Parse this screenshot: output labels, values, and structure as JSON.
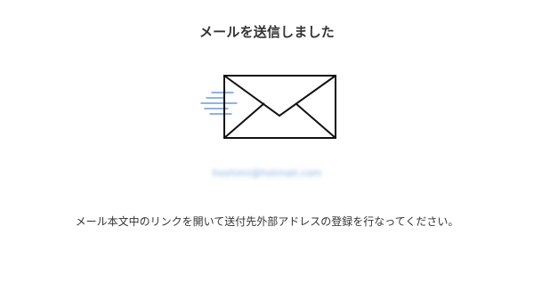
{
  "dialog": {
    "title": "メールを送信しました",
    "illustration_icon": "mail-sent-icon",
    "email_address": "hoshimi@hotmail.com",
    "message": "メール本文中のリンクを開いて送付先外部アドレスの登録を行なってください。"
  },
  "colors": {
    "text": "#333333",
    "envelope_stroke": "#111111",
    "motion_lines": "#6a9ad8",
    "email_blur": "#6a9ad8"
  }
}
